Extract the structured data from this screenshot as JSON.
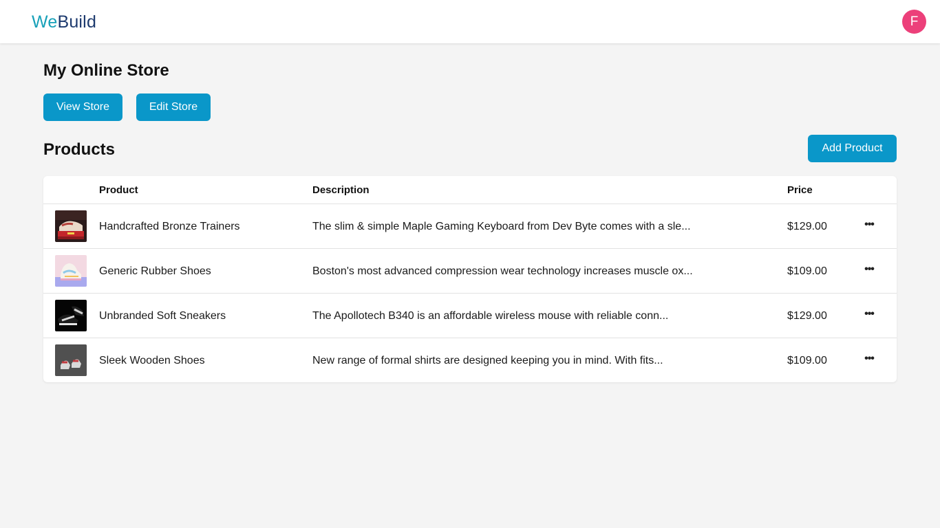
{
  "header": {
    "logo_part1": "We",
    "logo_part2": "Build",
    "avatar_initial": "F"
  },
  "store": {
    "title": "My Online Store",
    "view_label": "View Store",
    "edit_label": "Edit Store"
  },
  "products": {
    "title": "Products",
    "add_label": "Add Product",
    "columns": [
      "Product",
      "Description",
      "Price"
    ],
    "rows": [
      {
        "name": "Handcrafted Bronze Trainers",
        "description": "The slim & simple Maple Gaming Keyboard from Dev Byte comes with a sle...",
        "price": "$129.00",
        "thumb_icon": "red-sneaker-thumbnail"
      },
      {
        "name": "Generic Rubber Shoes",
        "description": "Boston's most advanced compression wear technology increases muscle ox...",
        "price": "$109.00",
        "thumb_icon": "pastel-sneaker-thumbnail"
      },
      {
        "name": "Unbranded Soft Sneakers",
        "description": "The Apollotech B340 is an affordable wireless mouse with reliable conn...",
        "price": "$129.00",
        "thumb_icon": "black-sneaker-thumbnail"
      },
      {
        "name": "Sleek Wooden Shoes",
        "description": "New range of formal shirts are designed keeping you in mind. With fits...",
        "price": "$109.00",
        "thumb_icon": "grey-sneaker-thumbnail"
      }
    ],
    "more_icon": "ellipsis-icon"
  },
  "colors": {
    "accent": "#0a97c9",
    "avatar": "#ec407a",
    "logo_we": "#17a0b8",
    "logo_build": "#1d3a6e",
    "background": "#f4f4f4"
  }
}
